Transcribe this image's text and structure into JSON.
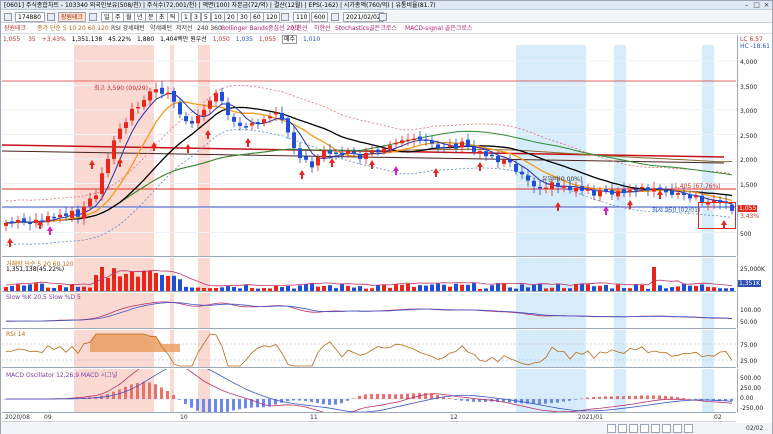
{
  "window": {
    "title": "[0601] 주식종합차트 - 103340 외국인보유(508/천) | 주식수(72,001/천) | 액면(100) 자본금(72/억) | 결산(12월) | EPS(-162) | 시가총액(760/억) | 유통비율(81.7)",
    "controls": [
      "–",
      "□",
      "×"
    ]
  },
  "toolbar": {
    "code": "174880",
    "stock_name": "장원테크",
    "period_buttons": [
      "주",
      "월",
      "년",
      "분",
      "초",
      "틱"
    ],
    "interval_buttons": [
      "1",
      "3",
      "5",
      "10",
      "20",
      "30",
      "60",
      "120"
    ],
    "count": "110",
    "count_label": "600",
    "date": "2021/02/02"
  },
  "info": {
    "name": "장원테크",
    "ma_label": "종가 단순 5 10 20 60 120",
    "rsi_label": "RSI 강세패턴",
    "pattern_label": "약세패턴",
    "resist_label": "저저선",
    "ma2_label": "240 360",
    "bollinger_label": "Bollinger Bands종심선 20,2",
    "trendline_label": "상한선",
    "lowline_label": "하한선",
    "stoch_label": "Stochastics골든크로스",
    "macd_label": "MACD-signal 골든크로스",
    "price": "1,055",
    "change_count": "35",
    "change": "+3.43%",
    "open": "1,351,138",
    "rate": "45.22%",
    "high": "1,880",
    "volume_label": "1,404백만 원우선",
    "v1": "1,050",
    "v2": "1,035",
    "v3": "1,055",
    "sell_label": "매수",
    "v4": "1,010",
    "lc_label": "LC 6.57",
    "hc_label": "HC -18.61"
  },
  "price_axis": {
    "ticks": [
      "4,000",
      "3,500",
      "3,000",
      "2,500",
      "2,000",
      "1,500",
      "1,000",
      "500"
    ],
    "current_tag": "1,055",
    "change_tag": "3.43%"
  },
  "annotations": {
    "high": "최고 3,590 (09/29)",
    "low": "최저 950 (02/01)",
    "level": "1,405 (67.76%)",
    "mid": "유입비(0.00%)"
  },
  "volume_pane": {
    "label": "거래량 단순 5 20 60 120",
    "sublabel": "1,351,138(45.22%)",
    "ticks": [
      "25,000K",
      "0K"
    ],
    "tag": "1,351K"
  },
  "stoch_pane": {
    "label": "Slow %K 20,5  Slow %D 5",
    "ticks": [
      "100.00",
      "50.00"
    ]
  },
  "rsi_pane": {
    "label": "RSI 14",
    "ticks": [
      "75.00",
      "25.00"
    ]
  },
  "macd_pane": {
    "label": "MACD Oscillator 12,26,9  MACD  시그널",
    "ticks": [
      "500.00",
      "250.00",
      "0.00",
      "-250.00"
    ]
  },
  "date_axis": {
    "labels": [
      "2020/08",
      "09",
      "10",
      "11",
      "12",
      "2021/01",
      "02"
    ]
  },
  "bottom": {
    "right_date": "02/02"
  },
  "colors": {
    "up": "#e8261c",
    "down": "#1f4fd6",
    "ma5": "#2330a8",
    "ma10": "#f39a1b",
    "ma20": "#000000",
    "ma60": "#2f8a2f",
    "ma120": "#8a6a2c",
    "trend": "#c8101a",
    "highlight_pink": "#fbd9d3",
    "highlight_blue": "#d7ecfb"
  }
}
